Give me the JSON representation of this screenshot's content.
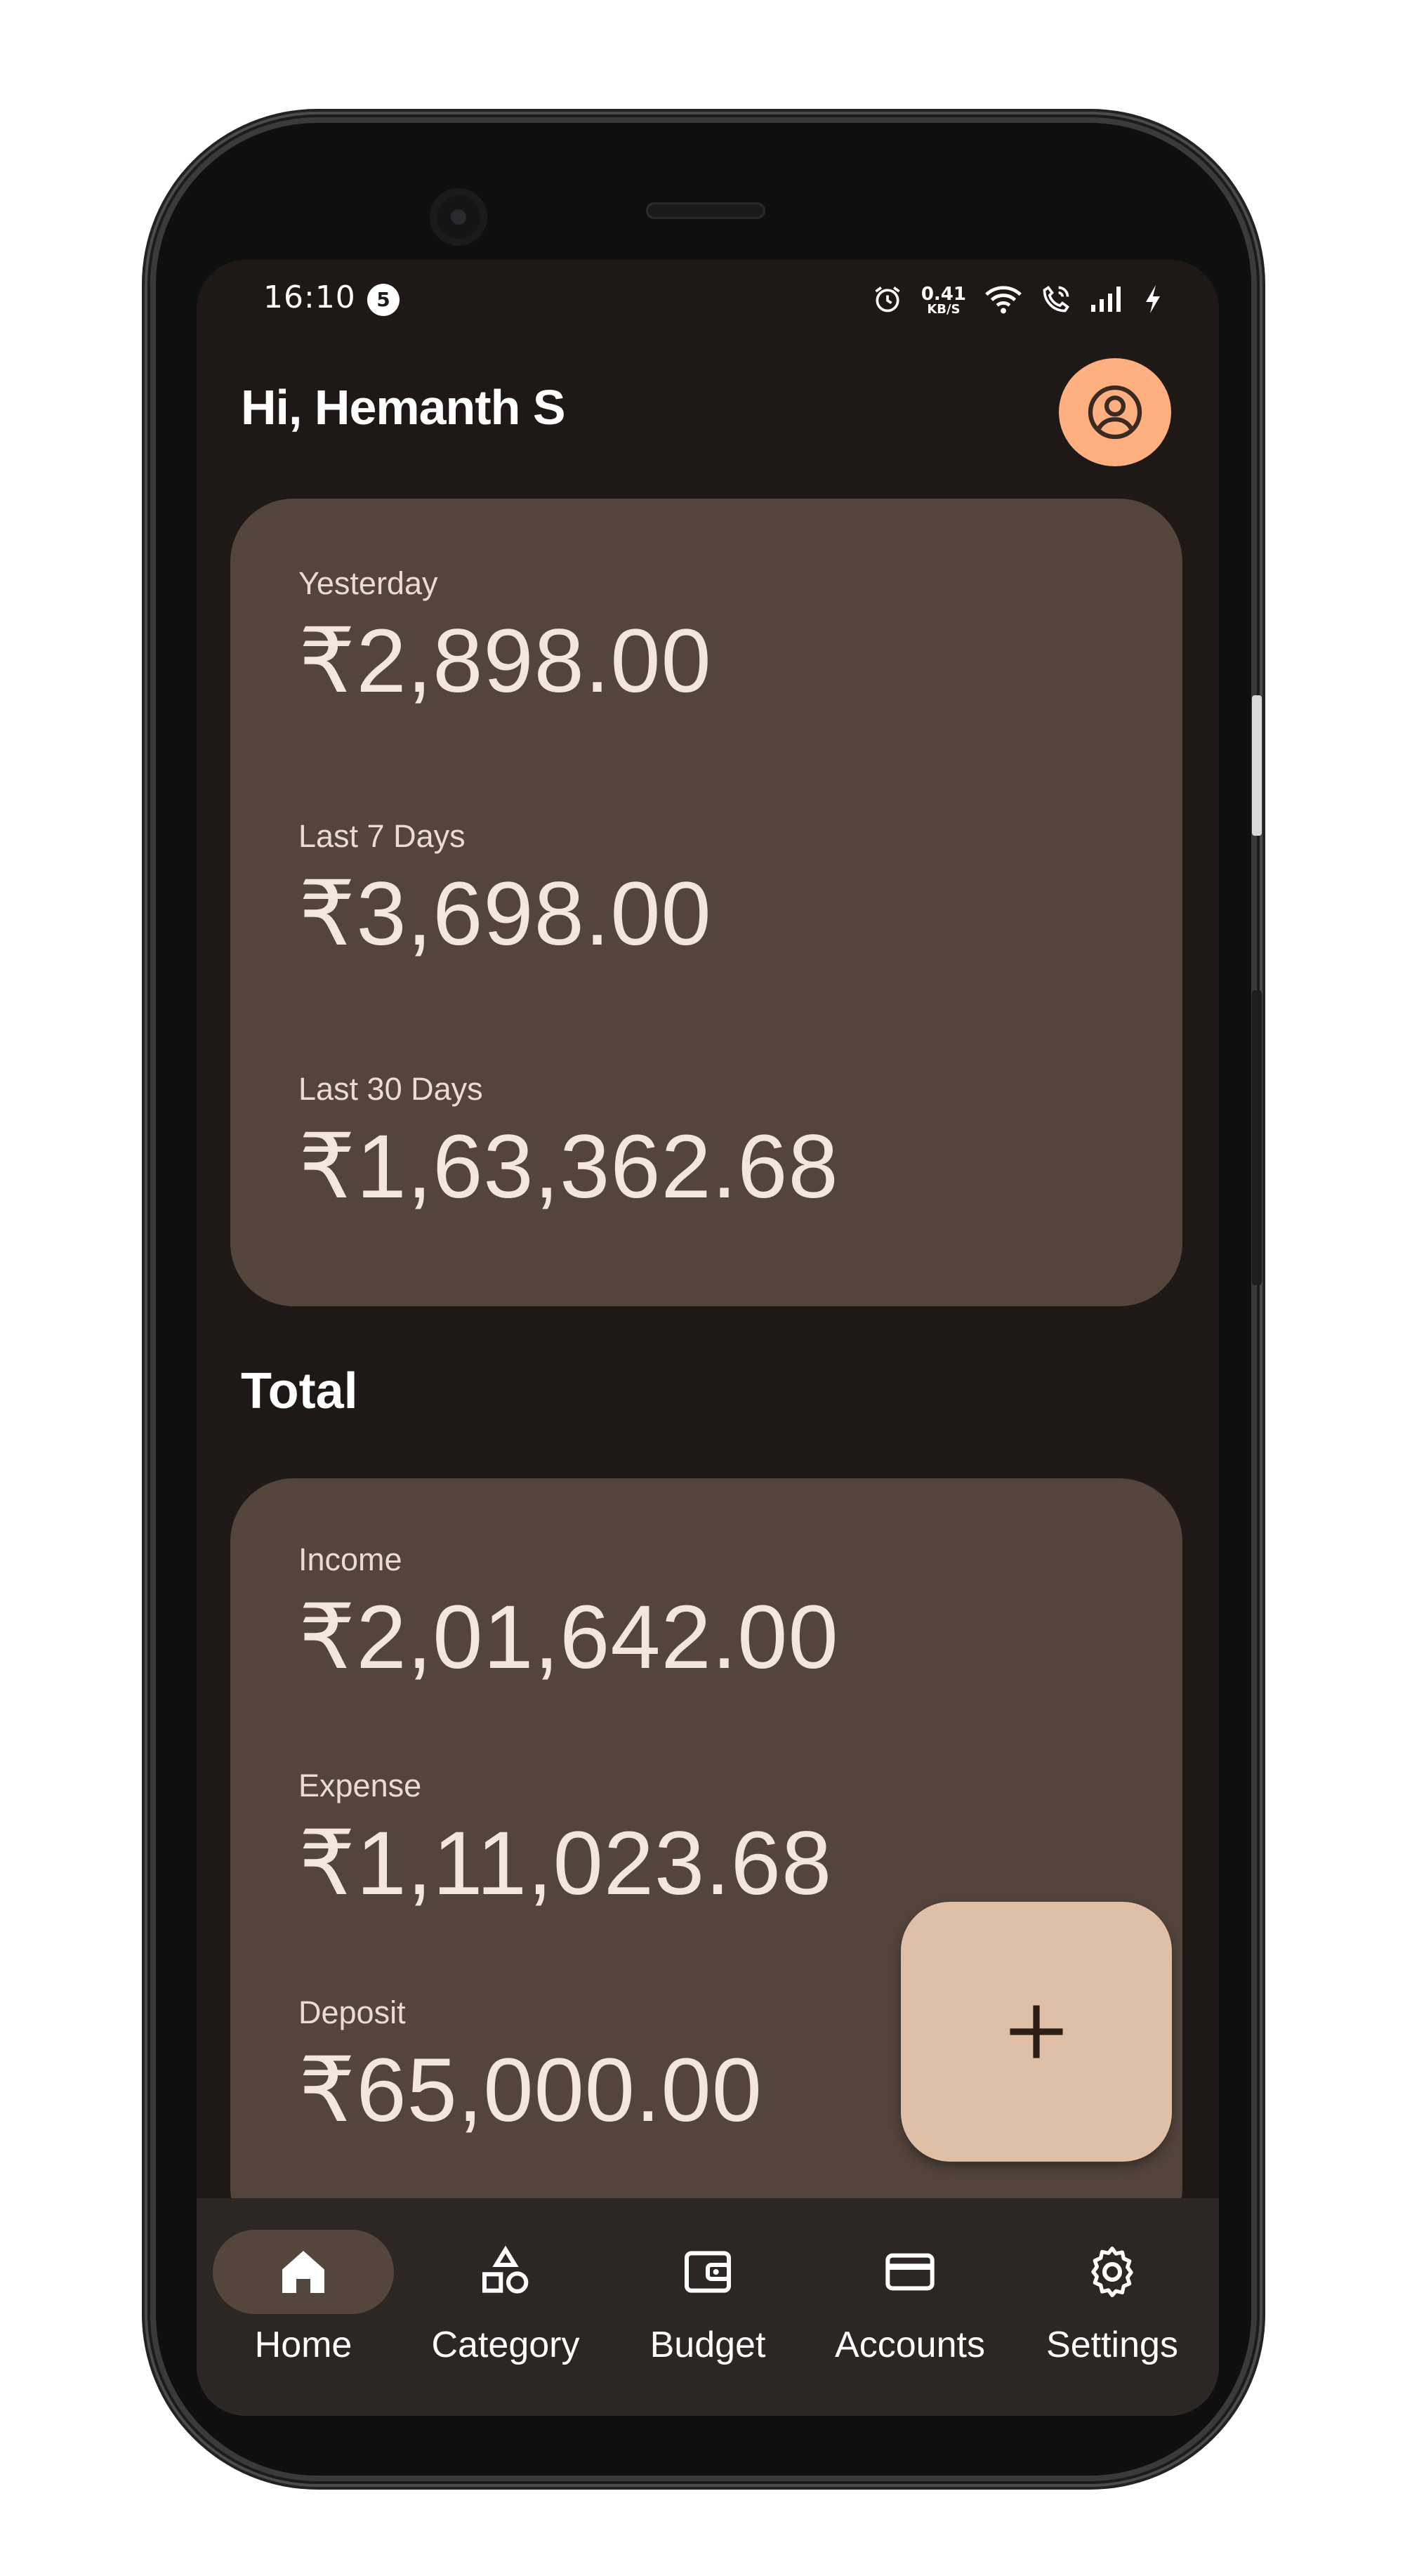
{
  "status_bar": {
    "time": "16:10",
    "notification_count": "5",
    "net_speed_value": "0.41",
    "net_speed_unit": "KB/S"
  },
  "header": {
    "greeting": "Hi, Hemanth S",
    "avatar_icon": "account-circle-icon",
    "avatar_color": "#ffb081"
  },
  "recent_card": {
    "items": [
      {
        "label": "Yesterday",
        "value": "₹2,898.00"
      },
      {
        "label": "Last 7 Days",
        "value": "₹3,698.00"
      },
      {
        "label": "Last 30 Days",
        "value": "₹1,63,362.68"
      }
    ]
  },
  "total_section": {
    "title": "Total",
    "items": [
      {
        "label": "Income",
        "value": "₹2,01,642.00"
      },
      {
        "label": "Expense",
        "value": "₹1,11,023.68"
      },
      {
        "label": "Deposit",
        "value": "₹65,000.00"
      }
    ]
  },
  "fab": {
    "icon": "plus-icon",
    "color": "#e0bfa7"
  },
  "bottom_nav": {
    "items": [
      {
        "label": "Home",
        "icon": "home-icon",
        "active": true
      },
      {
        "label": "Category",
        "icon": "shapes-icon",
        "active": false
      },
      {
        "label": "Budget",
        "icon": "wallet-icon",
        "active": false
      },
      {
        "label": "Accounts",
        "icon": "credit-card-icon",
        "active": false
      },
      {
        "label": "Settings",
        "icon": "gear-icon",
        "active": false
      }
    ]
  },
  "colors": {
    "background": "#1e1916",
    "card": "#53453c",
    "nav": "#2c2724",
    "active_pill": "#54463d"
  }
}
